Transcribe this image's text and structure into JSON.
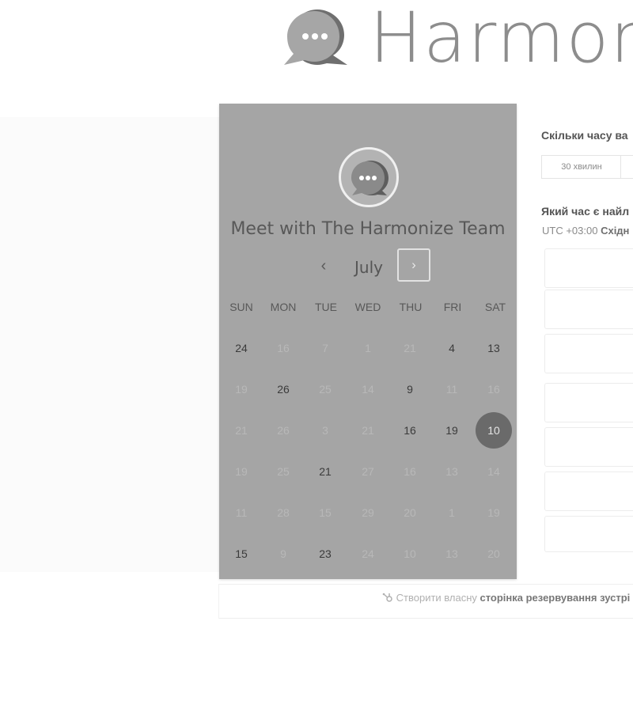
{
  "brand": {
    "name": "Harmon",
    "icon": "chat-bubble-logo"
  },
  "calendar": {
    "title": "Meet with The Harmonize Team",
    "month": "July",
    "prev_label": "‹",
    "next_label": "›",
    "weekdays": [
      "SUN",
      "MON",
      "TUE",
      "WED",
      "THU",
      "FRI",
      "SAT"
    ],
    "weeks": [
      [
        {
          "d": "24",
          "on": true
        },
        {
          "d": "16",
          "on": false
        },
        {
          "d": "7",
          "on": false
        },
        {
          "d": "1",
          "on": false
        },
        {
          "d": "21",
          "on": false
        },
        {
          "d": "4",
          "on": true
        },
        {
          "d": "13",
          "on": true
        }
      ],
      [
        {
          "d": "19",
          "on": false
        },
        {
          "d": "26",
          "on": true
        },
        {
          "d": "25",
          "on": false
        },
        {
          "d": "14",
          "on": false
        },
        {
          "d": "9",
          "on": true
        },
        {
          "d": "11",
          "on": false
        },
        {
          "d": "16",
          "on": false
        }
      ],
      [
        {
          "d": "21",
          "on": false
        },
        {
          "d": "26",
          "on": false
        },
        {
          "d": "3",
          "on": false
        },
        {
          "d": "21",
          "on": false
        },
        {
          "d": "16",
          "on": true
        },
        {
          "d": "19",
          "on": true
        },
        {
          "d": "10",
          "on": true,
          "selected": true
        }
      ],
      [
        {
          "d": "19",
          "on": false
        },
        {
          "d": "25",
          "on": false
        },
        {
          "d": "21",
          "on": true
        },
        {
          "d": "27",
          "on": false
        },
        {
          "d": "16",
          "on": false
        },
        {
          "d": "13",
          "on": false
        },
        {
          "d": "14",
          "on": false
        }
      ],
      [
        {
          "d": "11",
          "on": false
        },
        {
          "d": "28",
          "on": false
        },
        {
          "d": "15",
          "on": false
        },
        {
          "d": "29",
          "on": false
        },
        {
          "d": "20",
          "on": false
        },
        {
          "d": "1",
          "on": false
        },
        {
          "d": "19",
          "on": false
        }
      ],
      [
        {
          "d": "15",
          "on": true
        },
        {
          "d": "9",
          "on": false
        },
        {
          "d": "23",
          "on": true
        },
        {
          "d": "24",
          "on": false
        },
        {
          "d": "10",
          "on": false
        },
        {
          "d": "13",
          "on": false
        },
        {
          "d": "20",
          "on": false
        }
      ]
    ]
  },
  "booking": {
    "duration_question": "Скільки часу ва",
    "duration_option": "30 хвилин",
    "time_question": "Який час є найл",
    "timezone_prefix": "UTC +03:00 ",
    "timezone_name": "Східн",
    "slot_count": 7
  },
  "footer": {
    "link_prefix": "Створити власну ",
    "link_bold": "сторінка резервування зустрі",
    "icon": "hubspot-sprocket-icon"
  },
  "colors": {
    "card": "#a5a5a5",
    "selected_day": "#6a6a6a",
    "brand_text": "#8d8d8d"
  }
}
